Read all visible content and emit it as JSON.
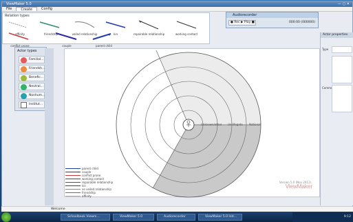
{
  "window": {
    "title": "ViewMaker 5.0",
    "controls": "— ▢ ✕"
  },
  "menu": [
    "File",
    "Create",
    "Config"
  ],
  "relation_panel": {
    "title": "Relation types",
    "items": [
      {
        "label": "affinity",
        "color": "#9b9b9b"
      },
      {
        "label": "friendship",
        "color": "#2a8f6d"
      },
      {
        "label": "veiled relationship",
        "color": "#777777"
      },
      {
        "label": "kin",
        "color": "#1e3ea8"
      },
      {
        "label": "repairable relationship",
        "color": "#333333"
      },
      {
        "label": "working contact",
        "color": "#333333"
      },
      {
        "label": "conflict prone",
        "color": "#c93b3b"
      },
      {
        "label": "couple",
        "color": "#2a2aa8"
      },
      {
        "label": "parent child",
        "color": "#1e3ea8"
      }
    ]
  },
  "actor_panel": {
    "title": "Actor types",
    "actors": [
      {
        "label": "Familial...",
        "color": "#e45b5b"
      },
      {
        "label": "Friendsh...",
        "color": "#f08a3c"
      },
      {
        "label": "Benefic...",
        "color": "#9bbb3f"
      },
      {
        "label": "Neutral...",
        "color": "#30b36b"
      },
      {
        "label": "Nonhum...",
        "color": "#2a9fb0"
      },
      {
        "label": "Institut...",
        "color": "#ffffff"
      }
    ]
  },
  "sectors": [
    "Unknown/other",
    "Unilifegate",
    "National"
  ],
  "legend": [
    {
      "label": "parent child",
      "color": "#1e3ea8"
    },
    {
      "label": "couple",
      "color": "#2a2aa8"
    },
    {
      "label": "conflict prone",
      "color": "#c93b3b"
    },
    {
      "label": "working contact",
      "color": "#444444"
    },
    {
      "label": "repairable relationship",
      "color": "#555555"
    },
    {
      "label": "kin",
      "color": "#1e3ea8"
    },
    {
      "label": "ve veiled relationship",
      "color": "#888888"
    },
    {
      "label": "friendship",
      "color": "#2a8f6d"
    },
    {
      "label": "affinity",
      "color": "#aaaaaa"
    }
  ],
  "watermark": {
    "version": "Version 5.0 (Nov 2011)",
    "brand": "ViewMaker"
  },
  "properties": {
    "title": "Actor properties",
    "type_label": "Type",
    "comment_label": "Comments"
  },
  "recorder": {
    "title": "Audiorecorder",
    "controls": "● Rec ▶ Play ■",
    "time": "000:00 (000000)"
  },
  "status": {
    "text": "Welcome"
  },
  "taskbar": {
    "items": [
      "Schoolbook Viewm...",
      "ViewMaker 5.0",
      "Audiorecorder",
      "ViewMaker 5.0 Intr..."
    ],
    "tray_time": "9:12"
  },
  "slide_text": "n"
}
